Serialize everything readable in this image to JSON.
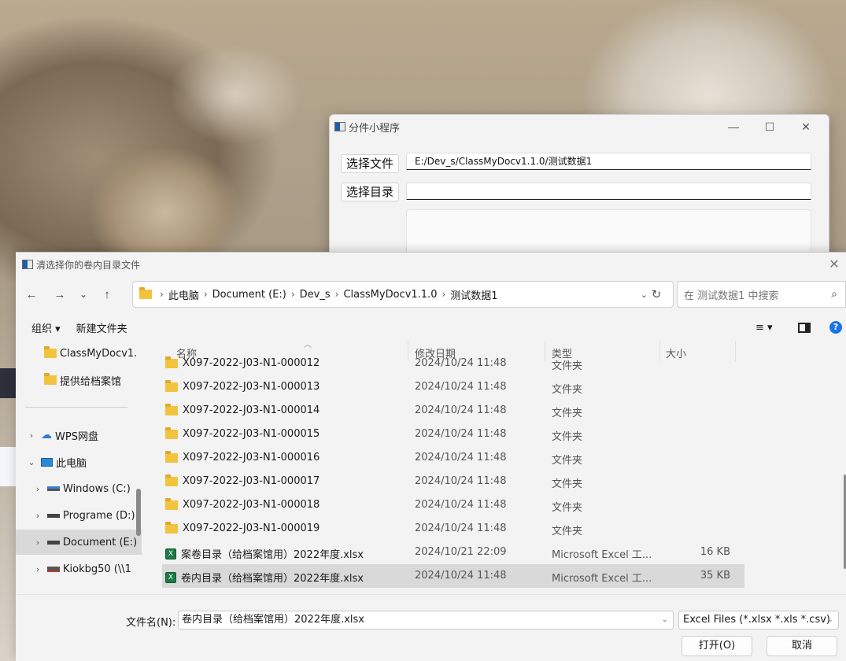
{
  "app_window": {
    "title": "分件小程序",
    "select_file_label": "选择文件",
    "file_path_value": "E:/Dev_s/ClassMyDocv1.1.0/测试数据1",
    "select_dir_label": "选择目录",
    "dir_path_value": "",
    "minimize": "—",
    "maximize": "☐",
    "close": "✕"
  },
  "dialog": {
    "title": "清选择你的卷内目录文件",
    "close": "✕",
    "nav": {
      "back": "←",
      "forward": "→",
      "recent": "⌄",
      "up": "↑"
    },
    "breadcrumb": [
      "此电脑",
      "Document (E:)",
      "Dev_s",
      "ClassMyDocv1.1.0",
      "测试数据1"
    ],
    "breadcrumb_sep": "›",
    "refresh": "↻",
    "search_placeholder": "在 测试数据1 中搜索",
    "toolbar": {
      "organize": "组织 ▾",
      "new_folder": "新建文件夹",
      "view": "≡ ▾",
      "preview": "▣",
      "help": "?"
    },
    "sidebar": [
      {
        "label": "ClassMyDocv1.",
        "icon": "folder-icon",
        "chevron": ""
      },
      {
        "label": "提供给档案馆",
        "icon": "folder-icon",
        "chevron": ""
      },
      {
        "label": "WPS网盘",
        "icon": "cloud-icon",
        "chevron": "›"
      },
      {
        "label": "此电脑",
        "icon": "computer-icon",
        "chevron": "⌄"
      },
      {
        "label": "Windows (C:)",
        "icon": "drive-icon",
        "chevron": "›"
      },
      {
        "label": "Programe (D:)",
        "icon": "drive-icon",
        "chevron": "›"
      },
      {
        "label": "Document (E:)",
        "icon": "drive-icon",
        "chevron": "›"
      },
      {
        "label": "Kiokbg50 (\\\\1",
        "icon": "network-drive-icon",
        "chevron": "›"
      }
    ],
    "columns": {
      "name": "名称",
      "date": "修改日期",
      "type": "类型",
      "size": "大小"
    },
    "files": [
      {
        "name": "X097-2022-J03-N1-000012",
        "date": "2024/10/24 11:48",
        "type": "文件夹",
        "size": "",
        "kind": "folder"
      },
      {
        "name": "X097-2022-J03-N1-000013",
        "date": "2024/10/24 11:48",
        "type": "文件夹",
        "size": "",
        "kind": "folder"
      },
      {
        "name": "X097-2022-J03-N1-000014",
        "date": "2024/10/24 11:48",
        "type": "文件夹",
        "size": "",
        "kind": "folder"
      },
      {
        "name": "X097-2022-J03-N1-000015",
        "date": "2024/10/24 11:48",
        "type": "文件夹",
        "size": "",
        "kind": "folder"
      },
      {
        "name": "X097-2022-J03-N1-000016",
        "date": "2024/10/24 11:48",
        "type": "文件夹",
        "size": "",
        "kind": "folder"
      },
      {
        "name": "X097-2022-J03-N1-000017",
        "date": "2024/10/24 11:48",
        "type": "文件夹",
        "size": "",
        "kind": "folder"
      },
      {
        "name": "X097-2022-J03-N1-000018",
        "date": "2024/10/24 11:48",
        "type": "文件夹",
        "size": "",
        "kind": "folder"
      },
      {
        "name": "X097-2022-J03-N1-000019",
        "date": "2024/10/24 11:48",
        "type": "文件夹",
        "size": "",
        "kind": "folder"
      },
      {
        "name": "案卷目录（给档案馆用）2022年度.xlsx",
        "date": "2024/10/21 22:09",
        "type": "Microsoft Excel 工...",
        "size": "16 KB",
        "kind": "xlsx"
      },
      {
        "name": "卷内目录（给档案馆用）2022年度.xlsx",
        "date": "2024/10/24 11:48",
        "type": "Microsoft Excel 工...",
        "size": "35 KB",
        "kind": "xlsx"
      }
    ],
    "filename_label": "文件名(N):",
    "filename_value": "卷内目录（给档案馆用）2022年度.xlsx",
    "filetype_value": "Excel Files (*.xlsx *.xls *.csv)",
    "open_label": "打开(O)",
    "cancel_label": "取消"
  },
  "colors": {
    "folder": "#f2c43d",
    "excel": "#1d7a46",
    "help": "#1a73e8",
    "selected_row": "#d9d9d9"
  }
}
